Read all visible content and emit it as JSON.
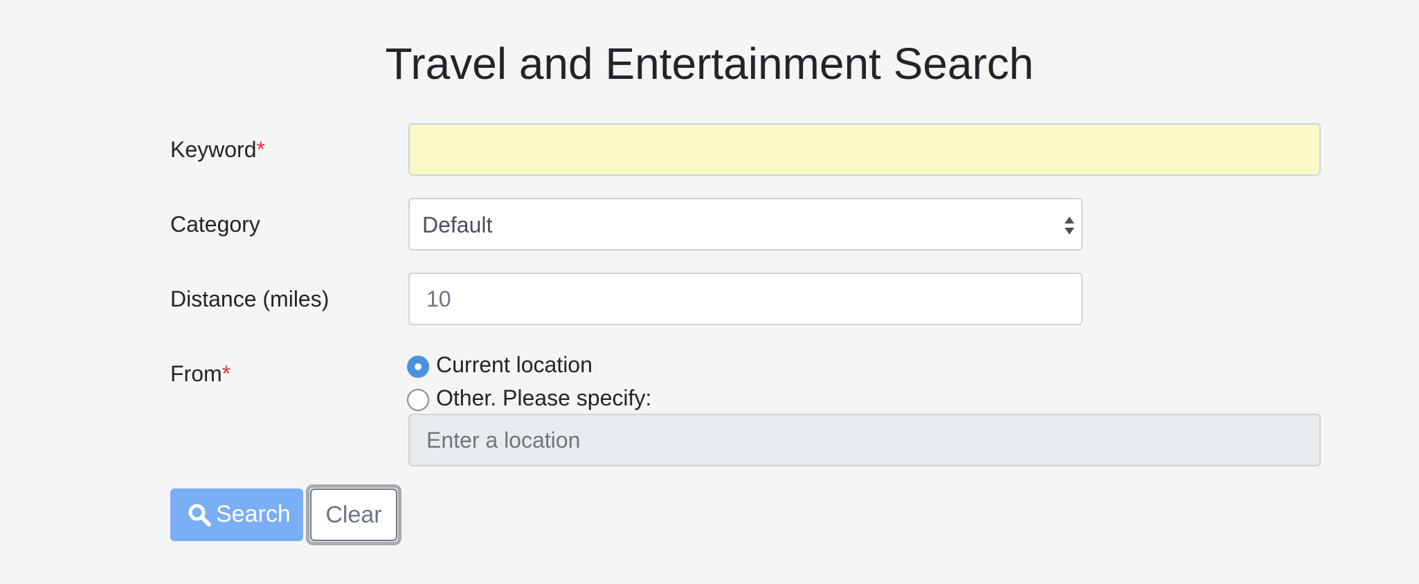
{
  "header": {
    "title": "Travel and Entertainment Search"
  },
  "form": {
    "keyword": {
      "label": "Keyword",
      "required_mark": "*",
      "value": ""
    },
    "category": {
      "label": "Category",
      "selected": "Default"
    },
    "distance": {
      "label": "Distance (miles)",
      "placeholder": "10",
      "value": ""
    },
    "from": {
      "label": "From",
      "required_mark": "*",
      "options": [
        {
          "label": "Current location",
          "checked": true
        },
        {
          "label": "Other. Please specify:",
          "checked": false
        }
      ],
      "location_placeholder": "Enter a location"
    }
  },
  "buttons": {
    "search_label": "Search",
    "search_icon": "search-icon",
    "clear_label": "Clear"
  },
  "colors": {
    "page_background": "#f5f5f5",
    "keyword_background": "#fafac8",
    "required": "#dc3545",
    "search_button": "#7aaef5",
    "radio_accent": "#4a90e2",
    "disabled_input": "#e9ecef"
  }
}
